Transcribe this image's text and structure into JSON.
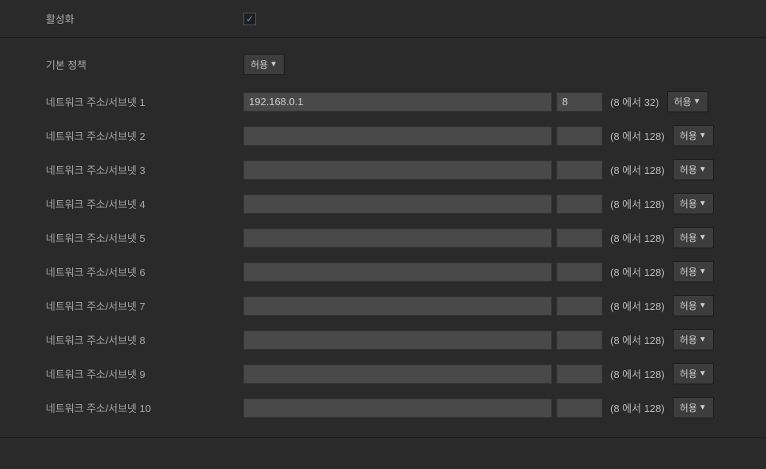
{
  "enable": {
    "label": "활성화",
    "checked": true,
    "checkmark": "✓"
  },
  "policy": {
    "label": "기본 정책",
    "value": "허용"
  },
  "allowLabel": "허용",
  "triangle": "▼",
  "rules": [
    {
      "label": "네트워크 주소/서브넷 1",
      "ip": "192.168.0.1",
      "subnet": "8",
      "range": "(8 에서 32)",
      "action": "허용"
    },
    {
      "label": "네트워크 주소/서브넷 2",
      "ip": "",
      "subnet": "",
      "range": "(8 에서 128)",
      "action": "허용"
    },
    {
      "label": "네트워크 주소/서브넷 3",
      "ip": "",
      "subnet": "",
      "range": "(8 에서 128)",
      "action": "허용"
    },
    {
      "label": "네트워크 주소/서브넷 4",
      "ip": "",
      "subnet": "",
      "range": "(8 에서 128)",
      "action": "허용"
    },
    {
      "label": "네트워크 주소/서브넷 5",
      "ip": "",
      "subnet": "",
      "range": "(8 에서 128)",
      "action": "허용"
    },
    {
      "label": "네트워크 주소/서브넷 6",
      "ip": "",
      "subnet": "",
      "range": "(8 에서 128)",
      "action": "허용"
    },
    {
      "label": "네트워크 주소/서브넷 7",
      "ip": "",
      "subnet": "",
      "range": "(8 에서 128)",
      "action": "허용"
    },
    {
      "label": "네트워크 주소/서브넷 8",
      "ip": "",
      "subnet": "",
      "range": "(8 에서 128)",
      "action": "허용"
    },
    {
      "label": "네트워크 주소/서브넷 9",
      "ip": "",
      "subnet": "",
      "range": "(8 에서 128)",
      "action": "허용"
    },
    {
      "label": "네트워크 주소/서브넷 10",
      "ip": "",
      "subnet": "",
      "range": "(8 에서 128)",
      "action": "허용"
    }
  ]
}
